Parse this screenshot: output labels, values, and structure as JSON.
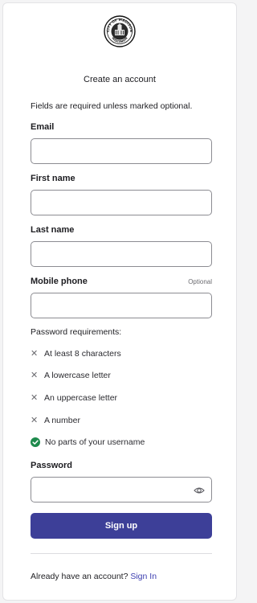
{
  "logo": {
    "icon": "city-of-madison-seal-icon",
    "top_text": "CITY OF MADISON",
    "bottom_text": "WISCONSIN"
  },
  "heading": "Create an account",
  "required_note": "Fields are required unless marked optional.",
  "fields": {
    "email": {
      "label": "Email",
      "value": ""
    },
    "first_name": {
      "label": "First name",
      "value": ""
    },
    "last_name": {
      "label": "Last name",
      "value": ""
    },
    "mobile_phone": {
      "label": "Mobile phone",
      "optional_label": "Optional",
      "value": ""
    },
    "password": {
      "label": "Password",
      "value": "",
      "toggle_icon": "eye-icon"
    }
  },
  "password_requirements": {
    "title": "Password requirements:",
    "items": [
      {
        "text": "At least 8 characters",
        "status": "unmet"
      },
      {
        "text": "A lowercase letter",
        "status": "unmet"
      },
      {
        "text": "An uppercase letter",
        "status": "unmet"
      },
      {
        "text": "A number",
        "status": "unmet"
      },
      {
        "text": "No parts of your username",
        "status": "met"
      }
    ]
  },
  "signup_button": "Sign up",
  "footer": {
    "text": "Already have an account?",
    "link": "Sign In"
  },
  "colors": {
    "primary": "#3d3f98",
    "link": "#3d3fb0",
    "success": "#1e8a4c",
    "input_border": "#8c8c92"
  }
}
